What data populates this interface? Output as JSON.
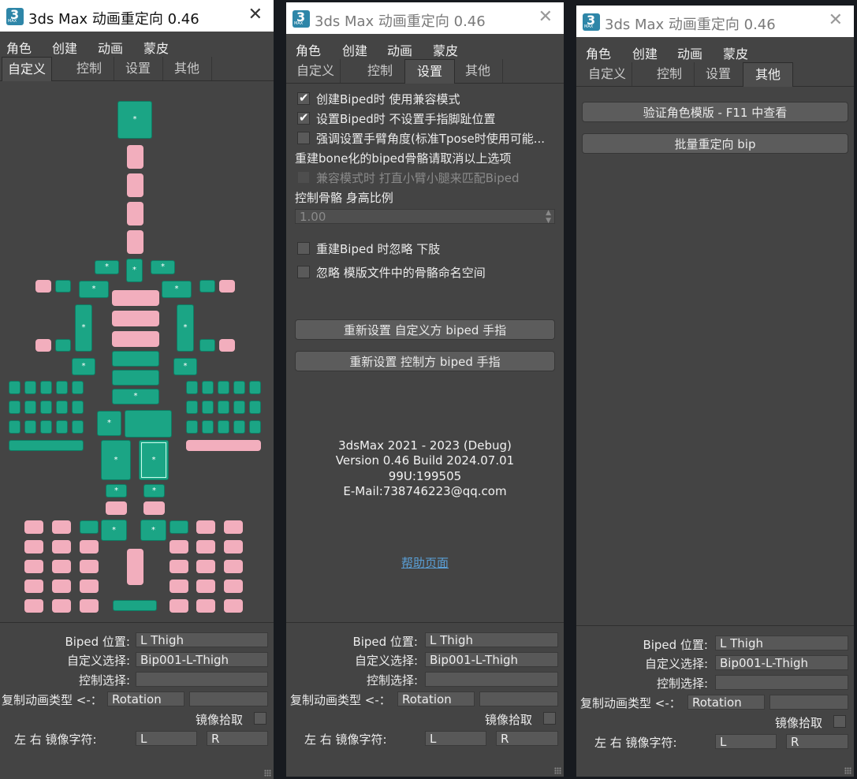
{
  "title": "3ds Max 动画重定向 0.46",
  "menu": [
    "角色",
    "创建",
    "动画",
    "蒙皮"
  ],
  "tabs": [
    "自定义",
    "控制",
    "设置",
    "其他"
  ],
  "bottom": {
    "biped_pos_label": "Biped 位置:",
    "biped_pos_value": "L Thigh",
    "custom_sel_label": "自定义选择:",
    "custom_sel_value": "Bip001-L-Thigh",
    "control_sel_label": "控制选择:",
    "control_sel_value": "",
    "copy_type_label": "复制动画类型 <-：",
    "copy_type_value": "Rotation",
    "copy_type_extra": "",
    "mirror_pick_label": "镜像拾取",
    "mirror_char_label": "左 右 镜像字符:",
    "mirror_left": "L",
    "mirror_right": "R"
  },
  "settings": {
    "opt1": "创建Biped时 使用兼容模式",
    "opt2": "设置Biped时 不设置手指脚趾位置",
    "opt3": "强调设置手臂角度(标准Tpose时使用可能...",
    "note": "重建bone化的biped骨骼请取消以上选项",
    "opt4": "兼容模式时 打直小臂小腿来匹配Biped",
    "ratio_label": "控制骨骼 身高比例",
    "ratio_value": "1.00",
    "opt5": "重建Biped 时忽略 下肢",
    "opt6": "忽略 模版文件中的骨骼命名空间",
    "btn_reset_custom": "重新设置 自定义方 biped 手指",
    "btn_reset_control": "重新设置 控制方 biped 手指",
    "about": [
      "3dsMax 2021 - 2023 (Debug)",
      "Version 0.46 Build 2024.07.01",
      "99U:199505",
      "E-Mail:738746223@qq.com"
    ],
    "help_link": "帮助页面"
  },
  "other": {
    "btn_verify": "验证角色模版 - F11 中查看",
    "btn_batch": "批量重定向 bip"
  },
  "colors": {
    "teal": "#1ba585",
    "pink": "#f2aebd",
    "panel": "#444444"
  },
  "star": "*"
}
